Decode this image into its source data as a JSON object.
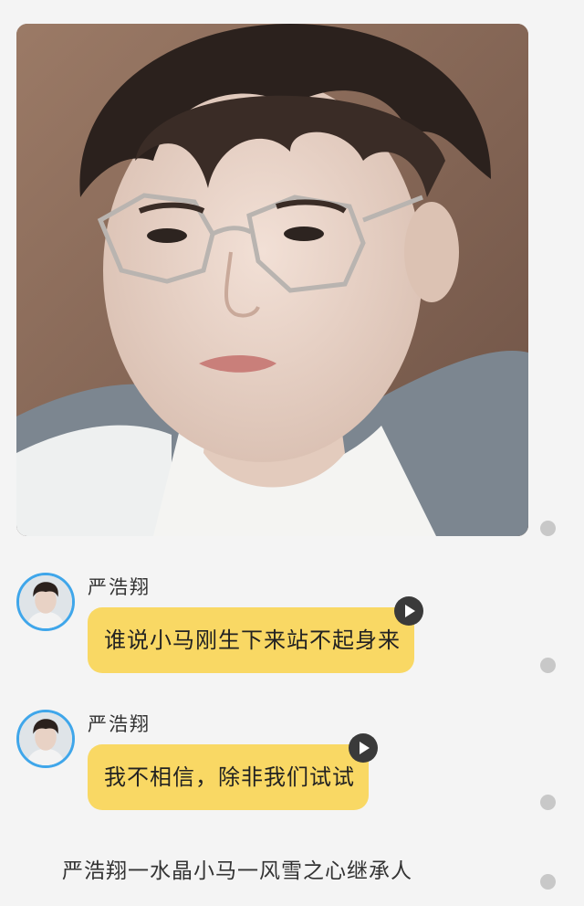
{
  "photo": {
    "alt_icon": "portrait-photo"
  },
  "messages": [
    {
      "sender": "严浩翔",
      "text": "谁说小马刚生下来站不起身来",
      "avatar_icon": "user-avatar",
      "action_icon": "play-icon"
    },
    {
      "sender": "严浩翔",
      "text": "我不相信，除非我们试试",
      "avatar_icon": "user-avatar",
      "action_icon": "play-icon"
    }
  ],
  "caption": "严浩翔一水晶小马一风雪之心继承人",
  "colors": {
    "background": "#f4f4f4",
    "bubble": "#f9d864",
    "avatar_ring": "#3fa6ea",
    "status_dot": "#c8c8c8"
  }
}
